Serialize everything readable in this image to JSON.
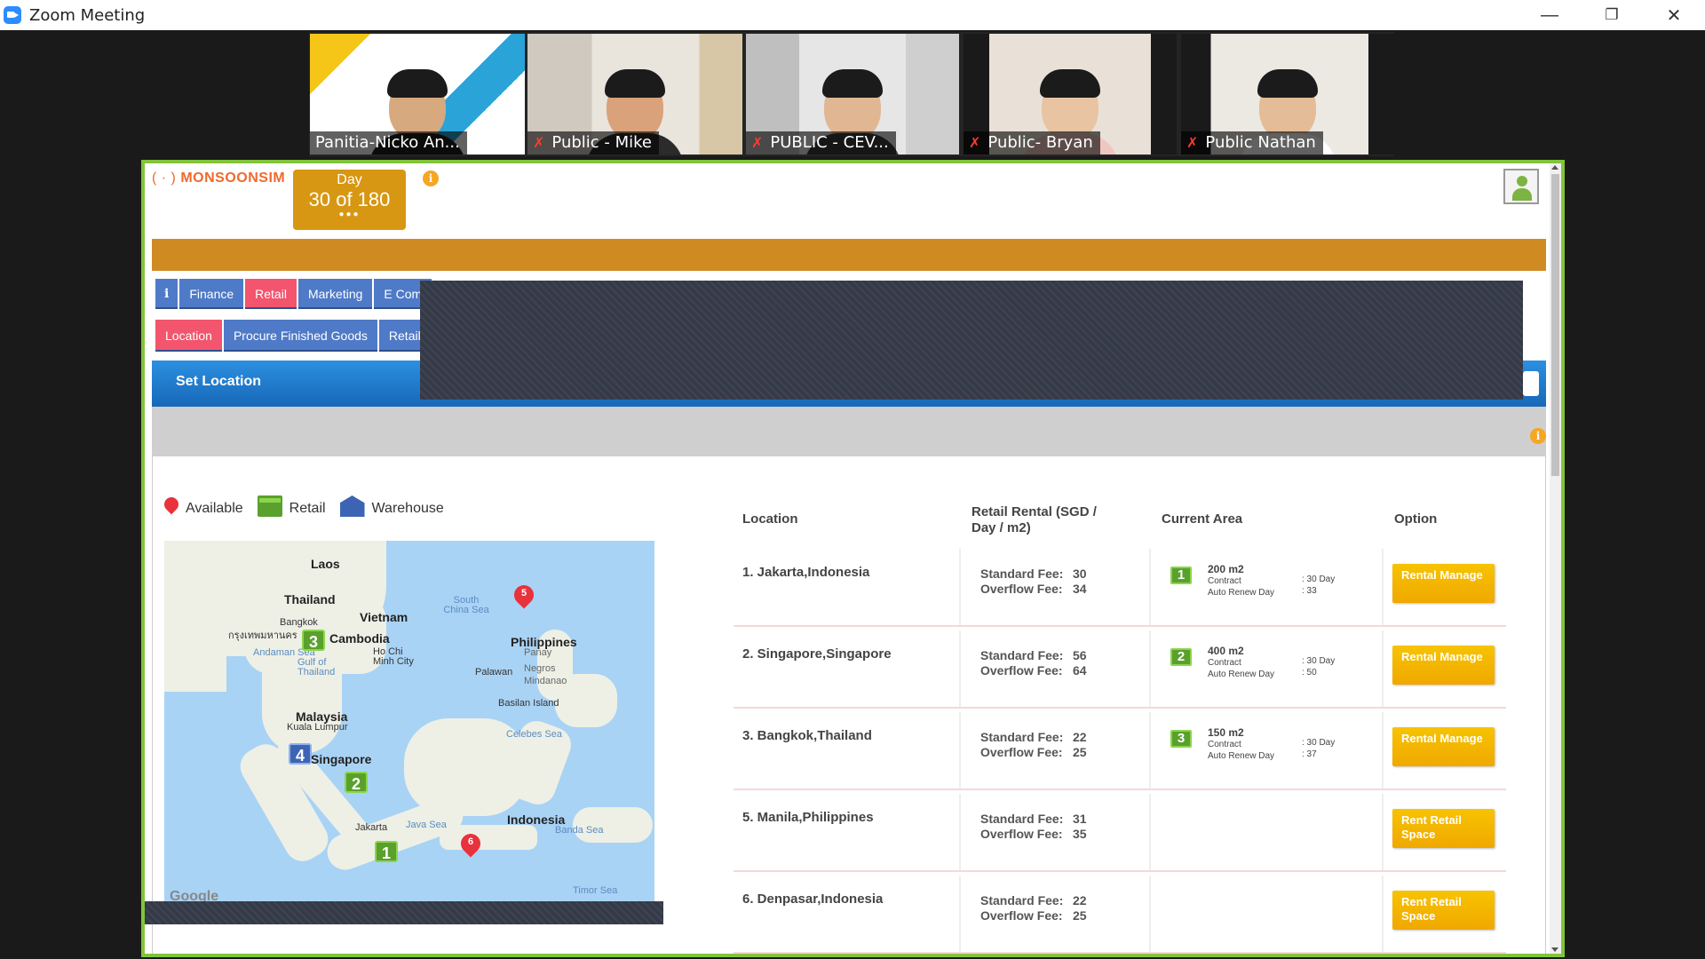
{
  "window": {
    "title": "Zoom Meeting",
    "minimize_glyph": "—",
    "restore_glyph": "❐",
    "close_glyph": "✕"
  },
  "participants": [
    {
      "name": "Panitia-Nicko An...",
      "muted": false
    },
    {
      "name": "Public - Mike",
      "muted": true
    },
    {
      "name": "PUBLIC - CEV...",
      "muted": true
    },
    {
      "name": "Public- Bryan",
      "muted": true
    },
    {
      "name": "Public Nathan",
      "muted": true
    }
  ],
  "app": {
    "logo": "MONSOONSIM",
    "day_label": "Day",
    "day_value": "30 of 180",
    "day_dots": "●●●",
    "info_glyph": "i",
    "tabs_main": [
      "i",
      "Finance",
      "Retail",
      "Marketing",
      "E Com"
    ],
    "tabs_sub": [
      "Location",
      "Procure Finished Goods",
      "Retail S"
    ],
    "section_title": "Set Location"
  },
  "legend": {
    "available": "Available",
    "retail": "Retail",
    "warehouse": "Warehouse"
  },
  "map": {
    "labels": [
      "Laos",
      "Thailand",
      "Vietnam",
      "South China Sea",
      "Philippines",
      "Bangkok",
      "กรุงเทพมหานคร",
      "Cambodia",
      "Andaman Sea",
      "Gulf of Thailand",
      "Ho Chi Minh City",
      "Panay",
      "Palawan",
      "Negros",
      "Mindanao",
      "Basilan Island",
      "Celebes Sea",
      "Malaysia",
      "Kuala Lumpur",
      "Singapore",
      "Jakarta",
      "Java Sea",
      "Indonesia",
      "Banda Sea",
      "Timor Sea"
    ],
    "google": "Google",
    "markers": {
      "retail": [
        "1",
        "2",
        "3"
      ],
      "warehouse": "4",
      "available": [
        "5",
        "6"
      ]
    }
  },
  "table": {
    "headers": {
      "location": "Location",
      "rental": "Retail Rental (SGD / Day / m2)",
      "area": "Current Area",
      "option": "Option"
    },
    "std_label": "Standard Fee:",
    "ovr_label": "Overflow Fee:",
    "contract_label": "Contract",
    "renew_label": "Auto Renew Day",
    "rows": [
      {
        "location": "1. Jakarta,Indonesia",
        "std": "30",
        "ovr": "34",
        "area_no": "1",
        "area": "200 m2",
        "contract": ": 30 Day",
        "renew": ": 33",
        "btn": "Rental Manage"
      },
      {
        "location": "2. Singapore,Singapore",
        "std": "56",
        "ovr": "64",
        "area_no": "2",
        "area": "400 m2",
        "contract": ": 30 Day",
        "renew": ": 50",
        "btn": "Rental Manage"
      },
      {
        "location": "3. Bangkok,Thailand",
        "std": "22",
        "ovr": "25",
        "area_no": "3",
        "area": "150 m2",
        "contract": ": 30 Day",
        "renew": ": 37",
        "btn": "Rental Manage"
      },
      {
        "location": "5. Manila,Philippines",
        "std": "31",
        "ovr": "35",
        "area_no": "",
        "area": "",
        "contract": "",
        "renew": "",
        "btn": "Rent Retail Space"
      },
      {
        "location": "6. Denpasar,Indonesia",
        "std": "22",
        "ovr": "25",
        "area_no": "",
        "area": "",
        "contract": "",
        "renew": "",
        "btn": "Rent Retail Space"
      }
    ]
  },
  "colors": {
    "accent_orange": "#d08a22",
    "tab_blue": "#4f7ac7",
    "tab_red": "#f2556d",
    "header_blue": "#1868b8",
    "button_yellow": "#f0a800",
    "zoom_active": "#82c43b"
  }
}
